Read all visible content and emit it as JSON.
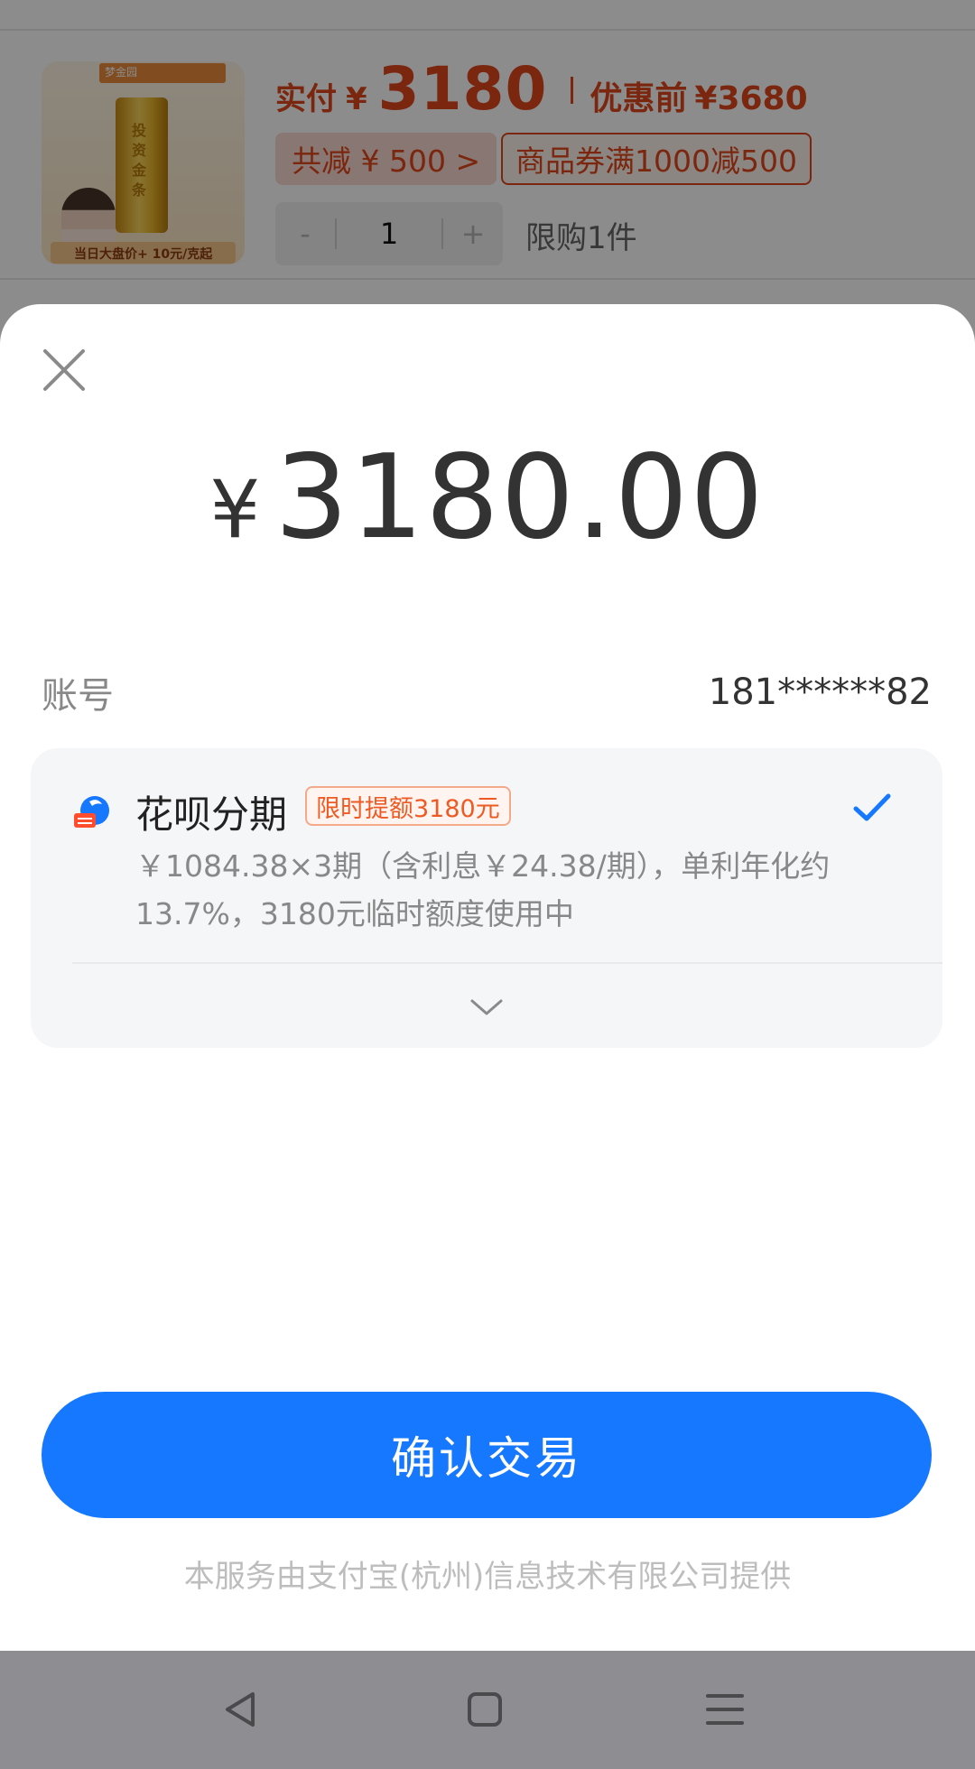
{
  "product": {
    "thumb_brand": "梦金园",
    "thumb_gold_text": "投资金条",
    "thumb_promo": "当日大盘价+ 10元/克起",
    "paid_label": "实付",
    "currency": "¥",
    "paid_amount": "3180",
    "before_label": "优惠前",
    "before_amount": "¥3680",
    "discount_label": "共减 ¥ 500 >",
    "coupon_label": "商品券满1000减500",
    "qty_minus": "-",
    "qty_value": "1",
    "qty_plus": "+",
    "limit_label": "限购1件"
  },
  "sheet": {
    "amount_currency": "¥",
    "amount_value": "3180.00",
    "account_label": "账号",
    "account_value": "181******82",
    "payment": {
      "title": "花呗分期",
      "badge": "限时提额3180元",
      "description": "￥1084.38×3期（含利息￥24.38/期），单利年化约13.7%，3180元临时额度使用中",
      "selected": true
    },
    "confirm_label": "确认交易",
    "footer_note": "本服务由支付宝(杭州)信息技术有限公司提供"
  },
  "colors": {
    "accent_blue": "#1677ff",
    "price_red": "#e0461a",
    "badge_orange": "#ee5a24"
  },
  "icons": [
    "close-icon",
    "huabei-icon",
    "checkmark-icon",
    "chevron-down-icon",
    "nav-back-icon",
    "nav-home-icon",
    "nav-menu-icon"
  ]
}
